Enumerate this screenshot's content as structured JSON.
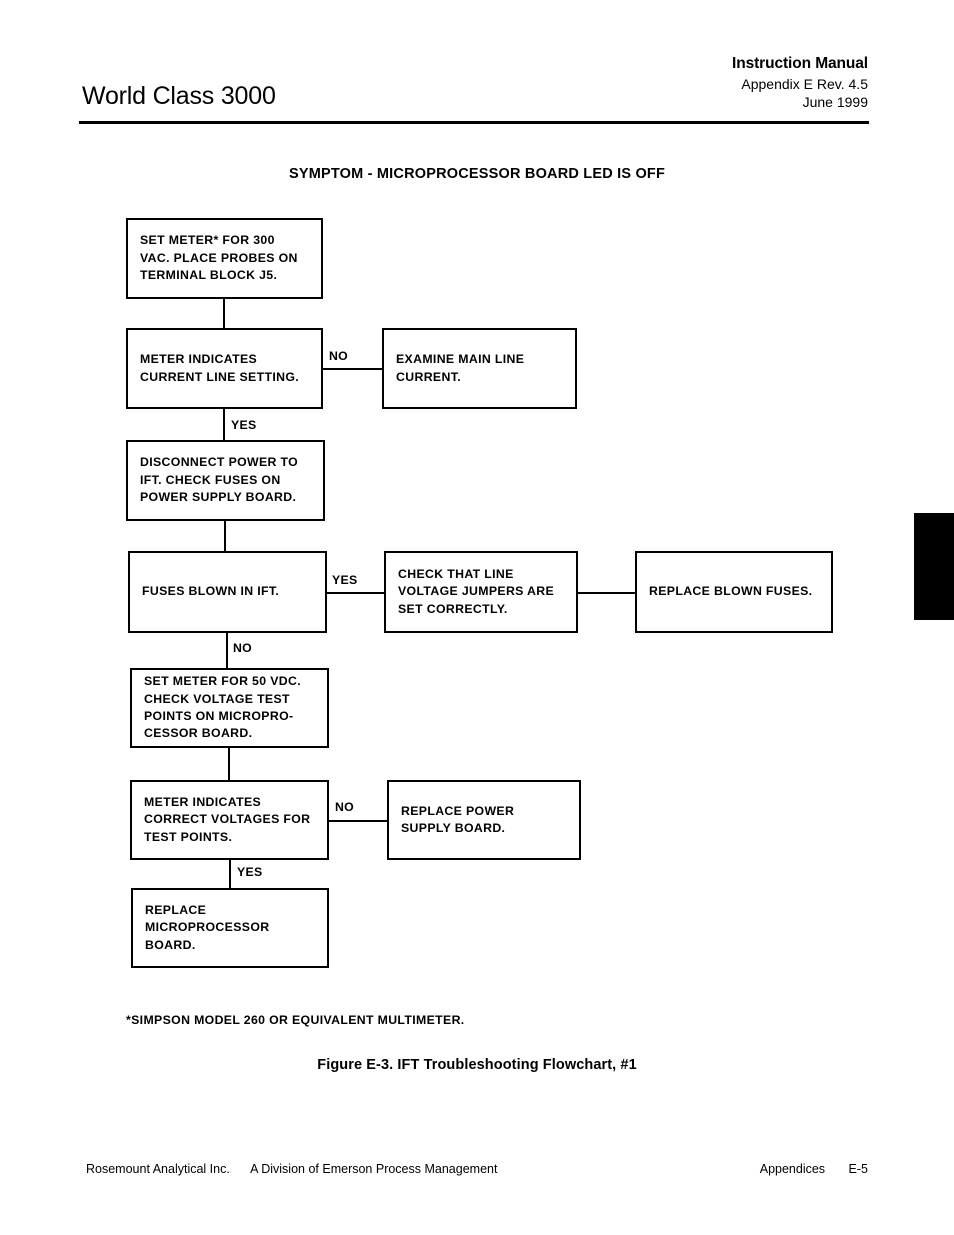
{
  "header": {
    "doc_title": "World Class 3000",
    "manual_label": "Instruction Manual",
    "appendix_rev": "Appendix E  Rev. 4.5",
    "date": "June 1999"
  },
  "figure": {
    "heading": "SYMPTOM - MICROPROCESSOR BOARD LED IS OFF",
    "caption": "Figure E-3.  IFT Troubleshooting Flowchart, #1",
    "footnote": "*SIMPSON  MODEL  260  OR  EQUIVALENT  MULTIMETER."
  },
  "flowchart": {
    "type": "flowchart",
    "nodes": [
      {
        "id": "n1",
        "text": "SET METER* FOR 300\nVAC. PLACE PROBES ON\nTERMINAL BLOCK J5."
      },
      {
        "id": "n2",
        "text": "METER INDICATES\nCURRENT LINE SETTING."
      },
      {
        "id": "n3",
        "text": "EXAMINE MAIN LINE\nCURRENT."
      },
      {
        "id": "n4",
        "text": "DISCONNECT POWER TO\nIFT. CHECK FUSES ON\nPOWER SUPPLY BOARD."
      },
      {
        "id": "n5",
        "text": "FUSES BLOWN IN IFT."
      },
      {
        "id": "n6",
        "text": "CHECK THAT LINE\nVOLTAGE JUMPERS ARE\nSET CORRECTLY."
      },
      {
        "id": "n7",
        "text": "REPLACE BLOWN FUSES."
      },
      {
        "id": "n8",
        "text": "SET METER FOR 50 VDC.\nCHECK VOLTAGE TEST\nPOINTS ON MICROPRO-\nCESSOR BOARD."
      },
      {
        "id": "n9",
        "text": "METER INDICATES\nCORRECT VOLTAGES FOR\nTEST POINTS."
      },
      {
        "id": "n10",
        "text": "REPLACE POWER\nSUPPLY BOARD."
      },
      {
        "id": "n11",
        "text": "REPLACE\nMICROPROCESSOR\nBOARD."
      }
    ],
    "edge_labels": {
      "e1_no": "NO",
      "e1_yes": "YES",
      "e2_yes": "YES",
      "e2_no": "NO",
      "e3_no": "NO",
      "e3_yes": "YES"
    }
  },
  "footer": {
    "company": "Rosemount Analytical Inc.",
    "division": "A Division of Emerson Process Management",
    "section": "Appendices",
    "page": "E-5"
  },
  "colors": {
    "ink": "#000000",
    "paper": "#ffffff"
  }
}
